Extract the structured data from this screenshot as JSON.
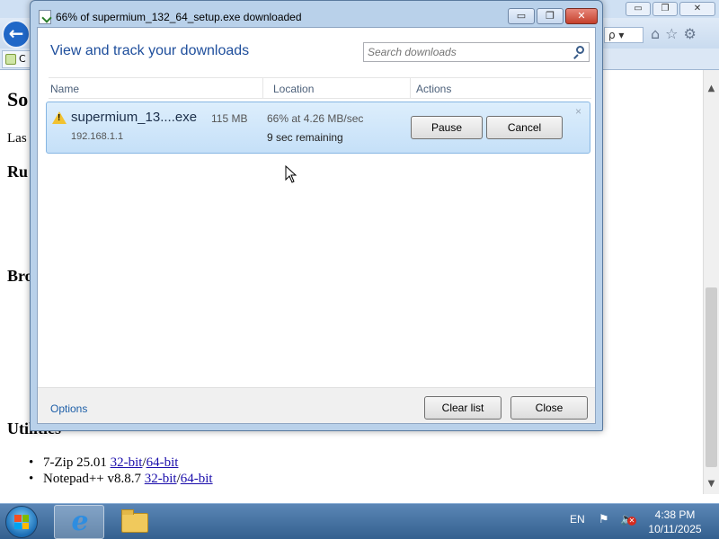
{
  "browser": {
    "back_label": "←",
    "search_fragment": "ρ ▾",
    "tab_fragment": "C",
    "window_buttons": [
      "▭",
      "❐",
      "✕"
    ],
    "tool_icons": [
      "⌂",
      "☆",
      "⚙"
    ]
  },
  "page": {
    "heading_fragment": "So",
    "last_fragment": "Las",
    "section1_fragment": "Ru",
    "section2_fragment": "Bro",
    "utilities_heading": "Utilities",
    "utilities": [
      {
        "name": "7-Zip 25.01",
        "link1": "32-bit",
        "sep": "/",
        "link2": "64-bit"
      },
      {
        "name": "Notepad++ v8.8.7",
        "link1": "32-bit",
        "sep": "/",
        "link2": "64-bit"
      }
    ]
  },
  "dialog": {
    "title": "66% of supermium_132_64_setup.exe downloaded",
    "window_buttons": [
      "▭",
      "❐",
      "✕"
    ],
    "heading": "View and track your downloads",
    "search_placeholder": "Search downloads",
    "columns": [
      "Name",
      "Location",
      "Actions"
    ],
    "download": {
      "name": "supermium_13....exe",
      "size": "115 MB",
      "host": "192.168.1.1",
      "progress_text": "66% at 4.26 MB/sec",
      "remaining": "9 sec remaining",
      "pause_label": "Pause",
      "cancel_label": "Cancel",
      "dismiss_label": "×",
      "warning_glyph": "!"
    },
    "options_label": "Options",
    "clear_list_label": "Clear list",
    "close_label": "Close"
  },
  "taskbar": {
    "language": "EN",
    "time": "4:38 PM",
    "date": "10/11/2025",
    "flag_glyph": "⚑",
    "sound_glyph": "🔈",
    "mute_glyph": "✕"
  },
  "colors": {
    "dialog_heading": "#1e4e9c",
    "row_highlight": "#c5e0f8",
    "link": "#1a0dab",
    "taskbar": "#34608f"
  }
}
